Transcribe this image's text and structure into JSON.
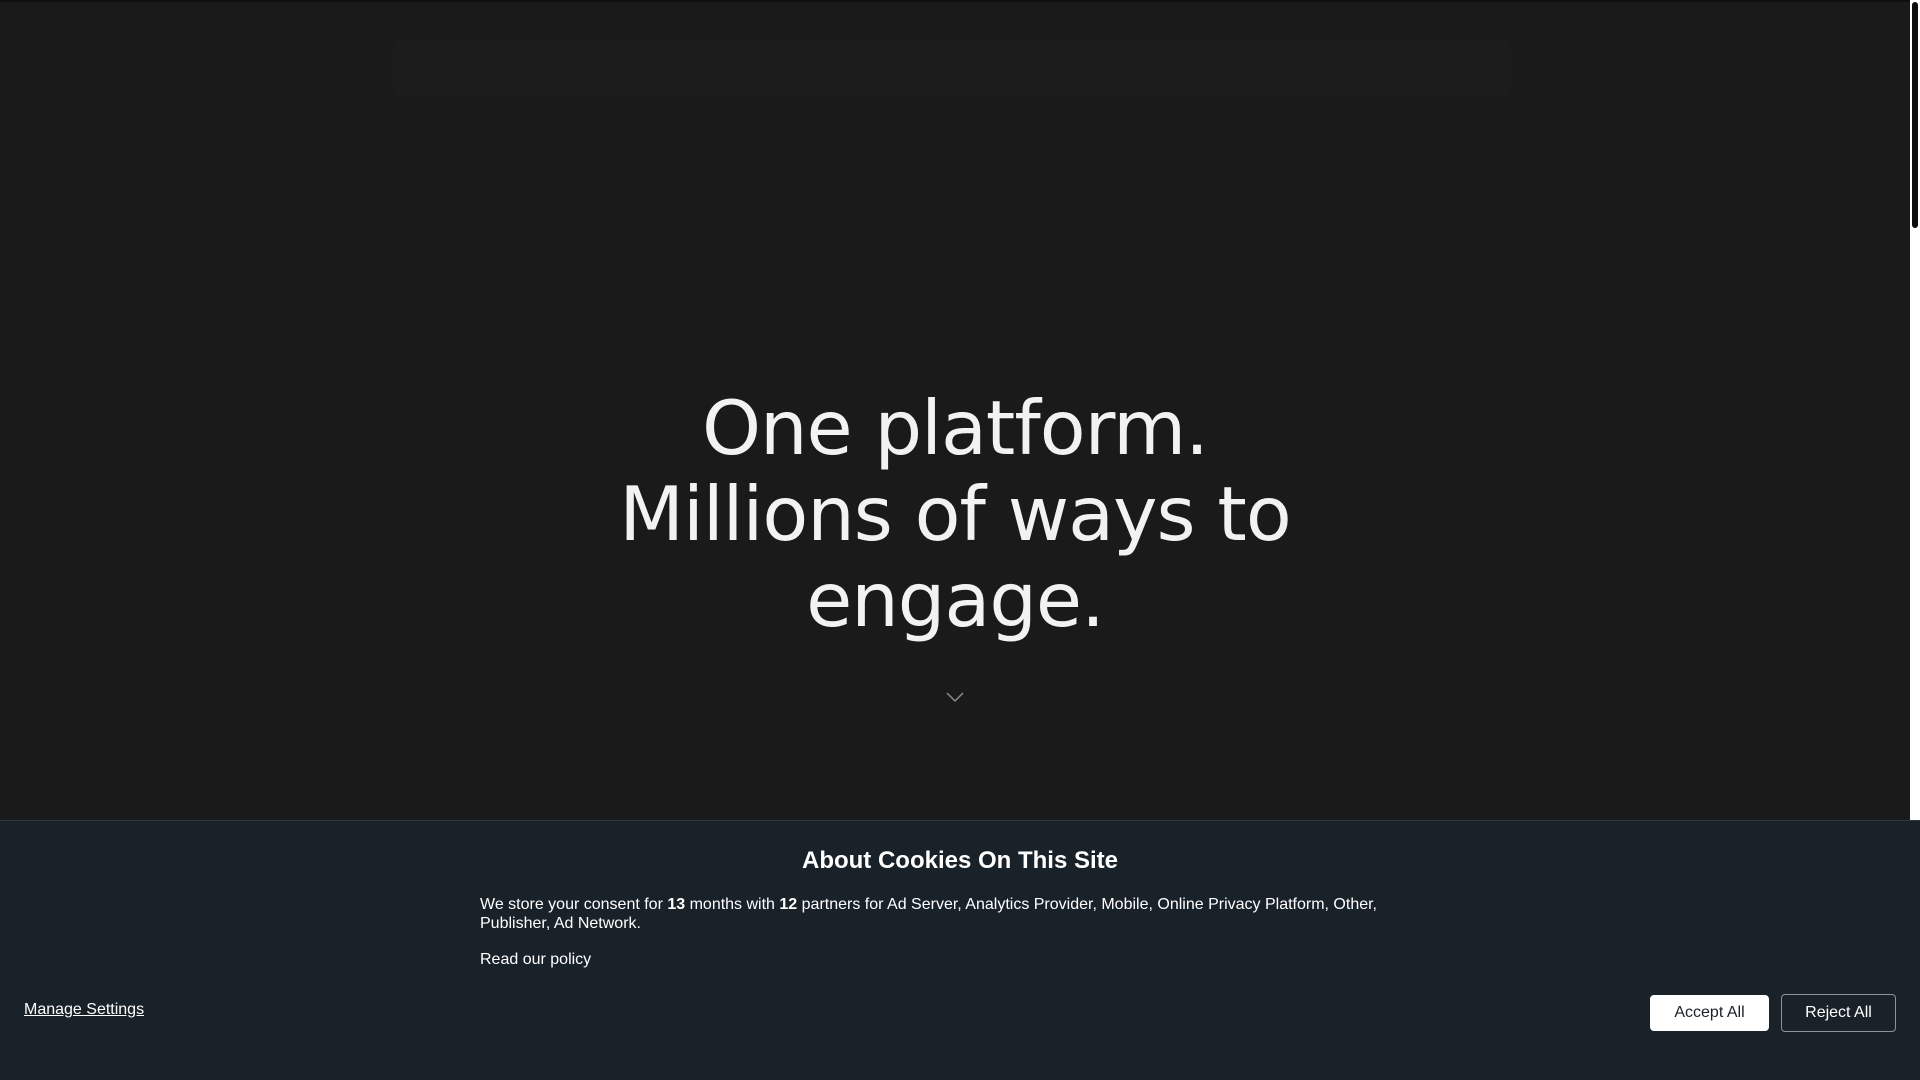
{
  "hero": {
    "line1": "One platform.",
    "line2": "Millions of ways to",
    "line3": "engage."
  },
  "icons": {
    "scroll": "chevron-down-icon"
  },
  "cookie_banner": {
    "title": "About Cookies On This Site",
    "text_prefix": "We store your consent for ",
    "months": "13",
    "text_middle": " months with ",
    "partners": "12",
    "text_suffix": " partners for Ad Server, Analytics Provider, Mobile, Online Privacy Platform, Other, Publisher, Ad Network.",
    "policy_link": "Read our policy",
    "manage_settings": "Manage Settings",
    "accept_all": "Accept All",
    "reject_all": "Reject All"
  },
  "colors": {
    "page_background": "#1a1a1a",
    "banner_background": "#192129",
    "hero_text": "#f2f2f2",
    "accept_button_bg": "#ffffff"
  }
}
